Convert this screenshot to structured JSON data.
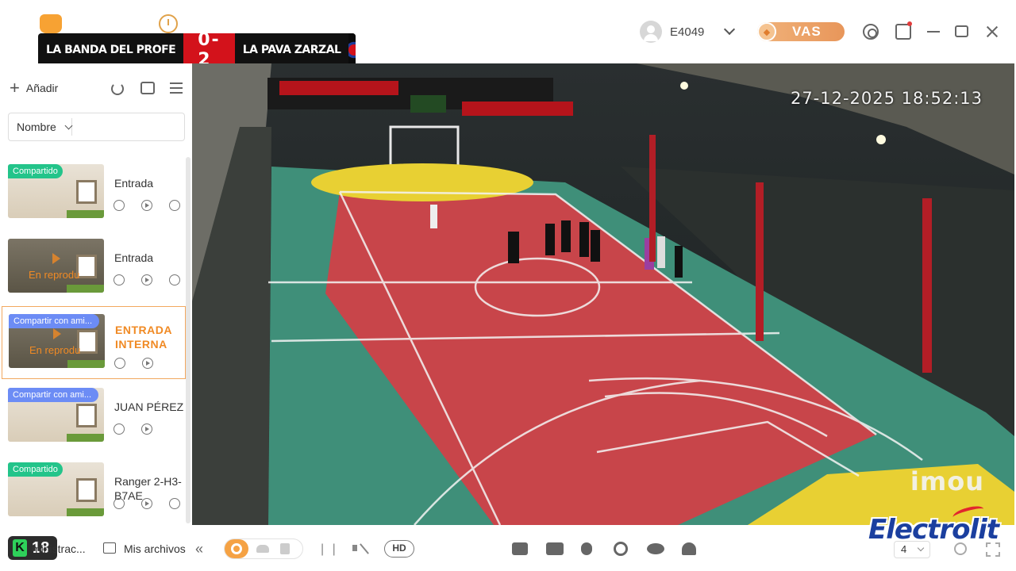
{
  "topbar": {
    "scoreboard": {
      "home_team": "LA BANDA DEL PROFE",
      "score": "0-2",
      "away_team": "LA PAVA ZARZAL"
    },
    "user": {
      "name": "E4049"
    },
    "vas_label": "VAS"
  },
  "sidebar": {
    "add_label": "Añadir",
    "sort_select": "Nombre",
    "search_placeholder": "",
    "devices": [
      {
        "badge": "Compartido",
        "badge_color": "#23c48a",
        "name": "Entrada",
        "status": "",
        "active": false,
        "icons": [
          "history-icon",
          "play-icon",
          "settings-icon"
        ]
      },
      {
        "badge": "",
        "name": "Entrada",
        "status": "En reprodu",
        "active": false,
        "icons": [
          "history-icon",
          "play-icon",
          "settings-icon"
        ]
      },
      {
        "badge": "Compartir con ami...",
        "badge_color": "#6c8cf5",
        "name": "ENTRADA INTERNA",
        "status": "En reprodu",
        "active": true,
        "icons": [
          "history-icon",
          "play-icon"
        ]
      },
      {
        "badge": "Compartir con ami...",
        "badge_color": "#6c8cf5",
        "name": "JUAN PÉREZ",
        "status": "",
        "active": false,
        "icons": [
          "history-icon",
          "play-icon"
        ]
      },
      {
        "badge": "Compartido",
        "badge_color": "#23c48a",
        "name": "Ranger 2-H3-B7AE",
        "status": "",
        "active": false,
        "icons": [
          "history-icon",
          "play-icon",
          "settings-icon"
        ]
      }
    ]
  },
  "video": {
    "timestamp": "27-12-2025 18:52:13",
    "watermark": "imou"
  },
  "bottombar": {
    "live_count": "18",
    "admin_label": "ministrac...",
    "files_label": "Mis archivos",
    "hd_label": "HD",
    "grid_value": "4"
  },
  "overlay": {
    "sponsor": "Electrolit"
  },
  "colors": {
    "accent": "#f5a244",
    "active_text": "#f08a24",
    "court_red": "#c8454a",
    "court_green": "#3f8f79",
    "court_yellow": "#e8d033"
  }
}
